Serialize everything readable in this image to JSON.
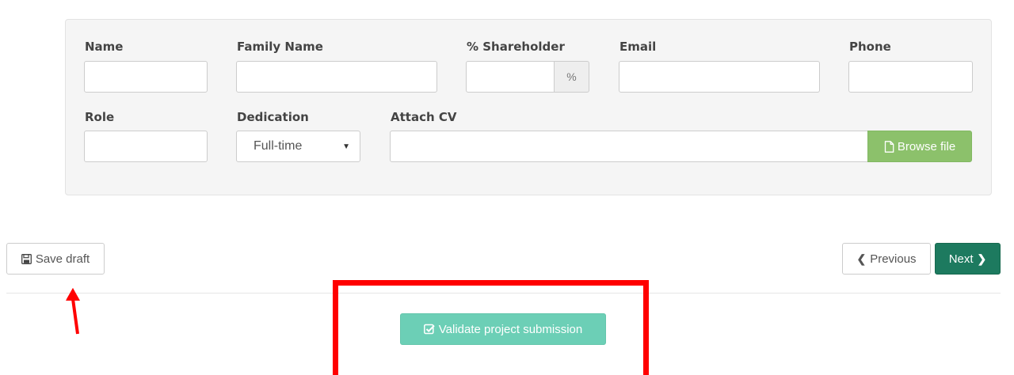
{
  "form": {
    "labels": {
      "name": "Name",
      "family_name": "Family Name",
      "shareholder": "% Shareholder",
      "email": "Email",
      "phone": "Phone",
      "role": "Role",
      "dedication": "Dedication",
      "attach_cv": "Attach CV"
    },
    "values": {
      "name": "",
      "family_name": "",
      "shareholder": "",
      "email": "",
      "phone": "",
      "role": "",
      "cv_file": ""
    },
    "shareholder_addon": "%",
    "dedication_selected": "Full-time",
    "browse_label": "Browse file"
  },
  "actions": {
    "save_draft": "Save draft",
    "previous": "Previous",
    "next": "Next",
    "validate": "Validate project submission"
  },
  "icons": {
    "save": "floppy-disk-icon",
    "previous": "chevron-left-icon",
    "next": "chevron-right-icon",
    "browse": "file-icon",
    "validate": "check-square-icon",
    "select": "caret-down-icon"
  },
  "colors": {
    "panel_bg": "#f5f5f5",
    "browse_green": "#8cc16b",
    "next_teal": "#1d7a5f",
    "validate_mint": "#6ccfb6",
    "annotation_red": "#ff0000"
  }
}
